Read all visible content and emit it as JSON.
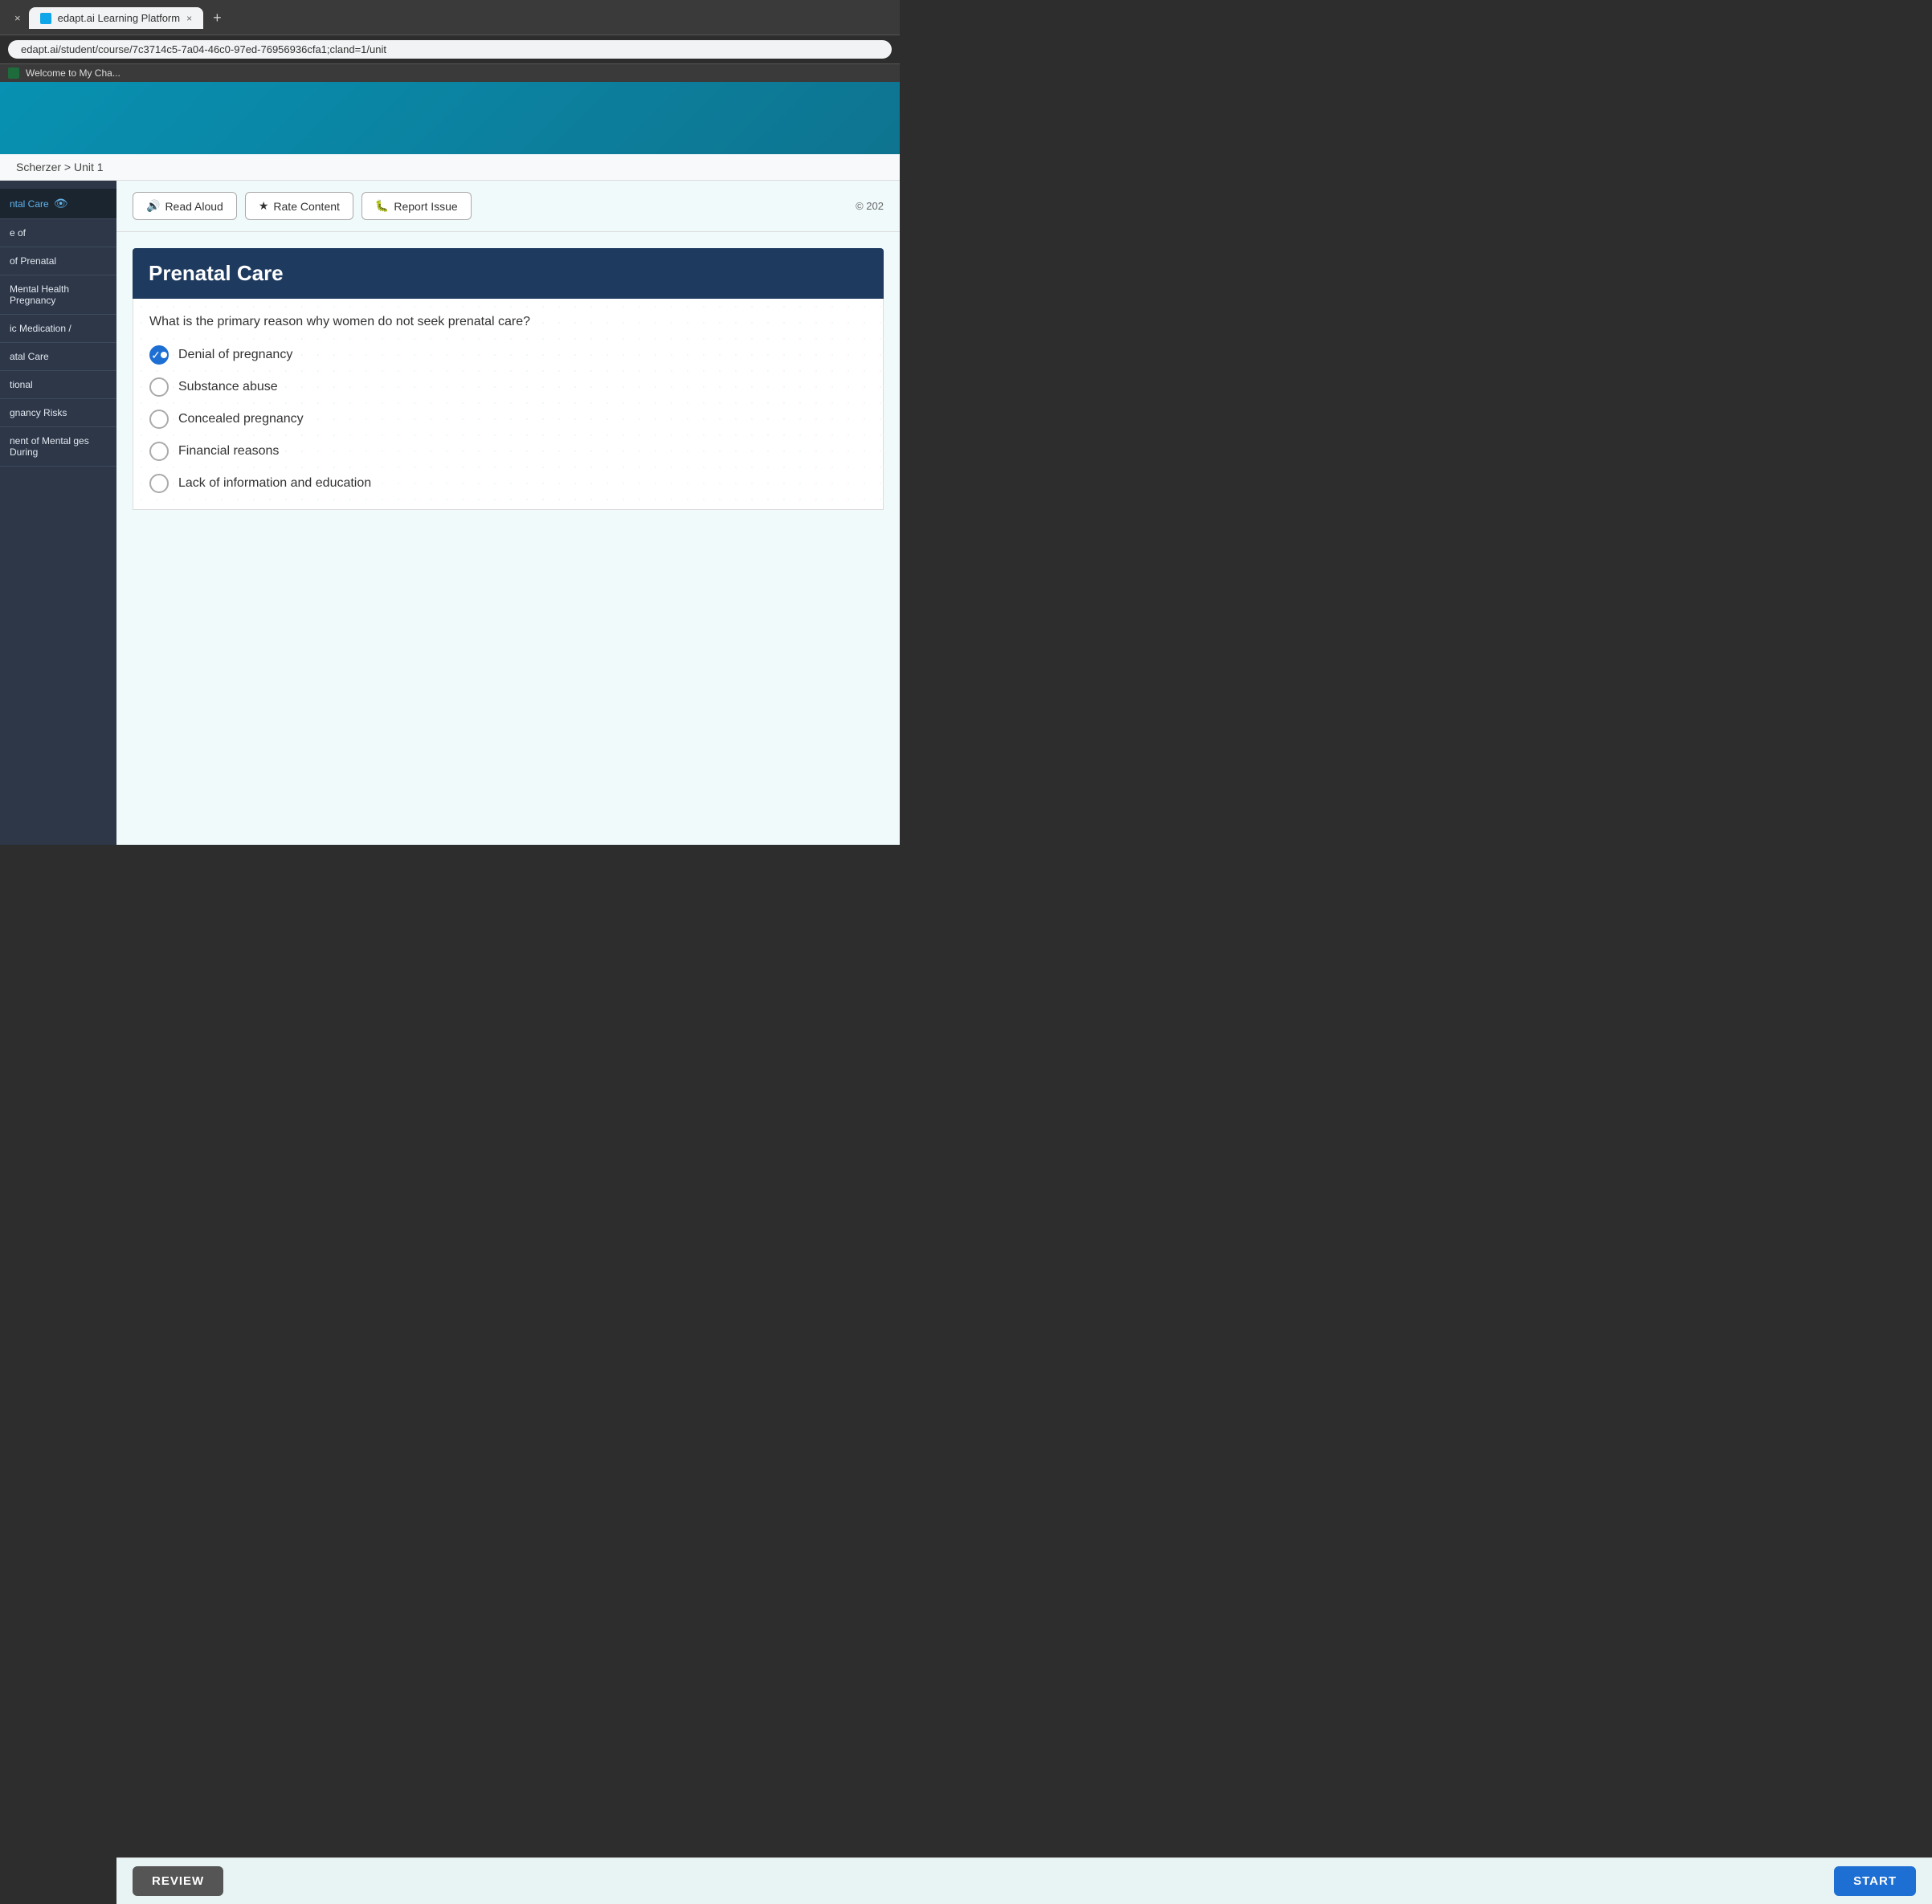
{
  "browser": {
    "tab_label": "edapt.ai Learning Platform",
    "tab_close": "×",
    "new_tab": "+",
    "address": "edapt.ai/student/course/7c3714c5-7a04-46c0-97ed-76956936cfa1;cland=1/unit",
    "bookmark_label": "Welcome to My Cha..."
  },
  "breadcrumb": {
    "text": "Scherzer > Unit 1"
  },
  "toolbar": {
    "read_aloud_label": "Read Aloud",
    "rate_content_label": "Rate Content",
    "report_issue_label": "Report Issue",
    "copyright": "© 202"
  },
  "sidebar": {
    "items": [
      {
        "label": "ntal Care",
        "icon": "👁",
        "active": true
      },
      {
        "label": "e of",
        "active": false
      },
      {
        "label": "of Prenatal",
        "active": false
      },
      {
        "label": "Mental Health Pregnancy",
        "active": false
      },
      {
        "label": "ic Medication /",
        "active": false
      },
      {
        "label": "atal Care",
        "active": false
      },
      {
        "label": "tional",
        "active": false
      },
      {
        "label": "gnancy Risks",
        "active": false
      },
      {
        "label": "nent of Mental ges During",
        "active": false
      }
    ]
  },
  "question": {
    "title": "Prenatal Care",
    "text": "What is the primary reason why women do not seek prenatal care?",
    "options": [
      {
        "id": "a",
        "text": "Denial of pregnancy",
        "selected": true
      },
      {
        "id": "b",
        "text": "Substance abuse",
        "selected": false
      },
      {
        "id": "c",
        "text": "Concealed pregnancy",
        "selected": false
      },
      {
        "id": "d",
        "text": "Financial reasons",
        "selected": false
      },
      {
        "id": "e",
        "text": "Lack of information and education",
        "selected": false
      }
    ]
  },
  "bottom_bar": {
    "review_label": "REVIEW",
    "start_label": "START"
  }
}
